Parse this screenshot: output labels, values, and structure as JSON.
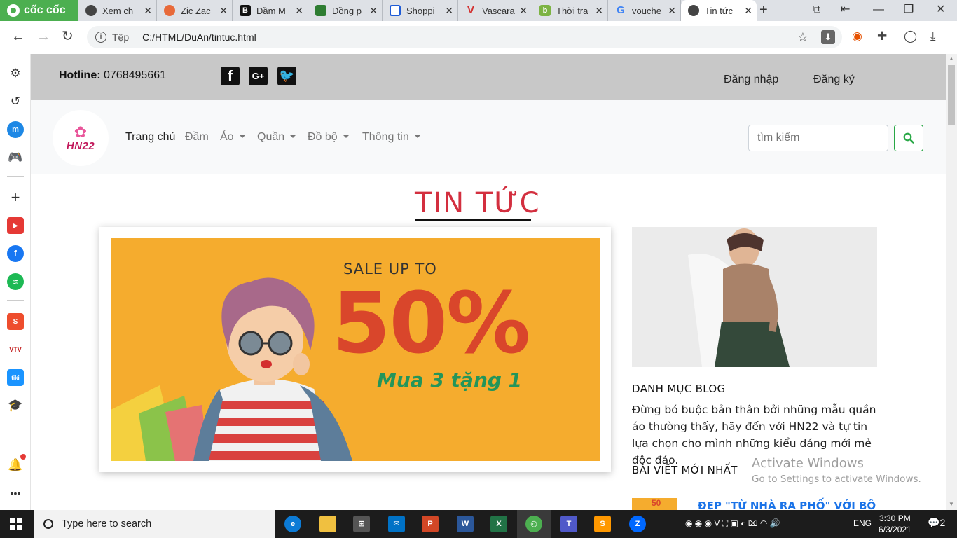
{
  "browser": {
    "brand": "cốc cốc",
    "tabs": [
      {
        "label": "Xem ch",
        "icon": "globe-icon"
      },
      {
        "label": "Zic Zac",
        "icon": "zic-zac-icon"
      },
      {
        "label": "Đầm M",
        "icon": "b-icon"
      },
      {
        "label": "Đồng p",
        "icon": "shop-icon"
      },
      {
        "label": "Shoppi",
        "icon": "flag-icon"
      },
      {
        "label": "Vascara",
        "icon": "v-icon"
      },
      {
        "label": "Thời tra",
        "icon": "b-green-icon"
      },
      {
        "label": "vouche",
        "icon": "google-icon"
      },
      {
        "label": "Tin tức",
        "icon": "globe-icon",
        "active": true
      }
    ],
    "address": {
      "security_label": "Tệp",
      "url": "C:/HTML/DuAn/tintuc.html"
    }
  },
  "site": {
    "hotline_label": "Hotline:",
    "hotline_number": "0768495661",
    "social": [
      {
        "name": "facebook-icon",
        "glyph": "f"
      },
      {
        "name": "google-plus-icon",
        "glyph": "G+"
      },
      {
        "name": "twitter-icon",
        "glyph": "t"
      }
    ],
    "auth": {
      "login": "Đăng nhập",
      "register": "Đăng ký"
    },
    "logo_text": "HN22",
    "menu": [
      {
        "label": "Trang chủ",
        "active": true,
        "dropdown": false
      },
      {
        "label": "Đầm",
        "dropdown": false
      },
      {
        "label": "Áo",
        "dropdown": true
      },
      {
        "label": "Quần",
        "dropdown": true
      },
      {
        "label": "Đồ bộ",
        "dropdown": true
      },
      {
        "label": "Thông tin",
        "dropdown": true
      }
    ],
    "search": {
      "placeholder": "tìm kiếm"
    }
  },
  "main": {
    "page_title": "TIN TỨC",
    "banner": {
      "sale_text": "SALE UP TO",
      "percent": "50%",
      "promo": "Mua 3 tặng 1"
    },
    "blog": {
      "category_heading": "DANH MỤC BLOG",
      "description": "Đừng bó buộc bản thân bởi những mẫu quần áo thường thấy, hãy đến với HN22 và tự tin lựa chọn cho mình những kiểu dáng mới mẻ độc đáo.",
      "latest_heading": "BÀI VIẾT MỚI NHẤT",
      "latest_post_title": "ĐẸP \"TỪ NHÀ RA PHỐ\" VỚI BỘ"
    }
  },
  "watermark": {
    "line1": "Activate Windows",
    "line2": "Go to Settings to activate Windows."
  },
  "taskbar": {
    "search_placeholder": "Type here to search",
    "language": "ENG",
    "time": "3:30 PM",
    "date": "6/3/2021",
    "notifications": "2"
  },
  "colors": {
    "accent_red": "#d32f3f",
    "search_green": "#28a745",
    "banner_orange": "#f5ac2e",
    "brand_green": "#4caf50"
  }
}
